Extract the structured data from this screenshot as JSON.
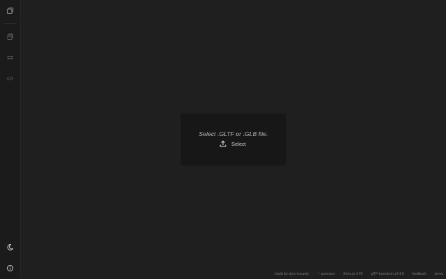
{
  "sidebar": {
    "items": [
      {
        "icon": "model-icon",
        "label": ""
      },
      {
        "icon": "textures-icon",
        "label": ""
      },
      {
        "icon": "list-icon",
        "label": ""
      },
      {
        "icon": "code-icon",
        "label": ""
      }
    ],
    "bottom": [
      {
        "icon": "theme-moon-icon"
      },
      {
        "icon": "info-icon"
      }
    ]
  },
  "dropzone": {
    "prompt": "Select .GLTF or .GLB file.",
    "select_label": "Select",
    "icon": "upload-icon"
  },
  "footer": {
    "links": [
      "made by don mccurdy",
      "♡ sponsors",
      "three.js r140",
      "glTF-transform v2.4.6",
      "feedback",
      "terms"
    ],
    "separator": "·"
  },
  "colors": {
    "background": "#1f1f1f",
    "sidebar": "#1b1b1b",
    "panel": "#171717",
    "text": "#bdbdbd",
    "muted": "#777777"
  }
}
